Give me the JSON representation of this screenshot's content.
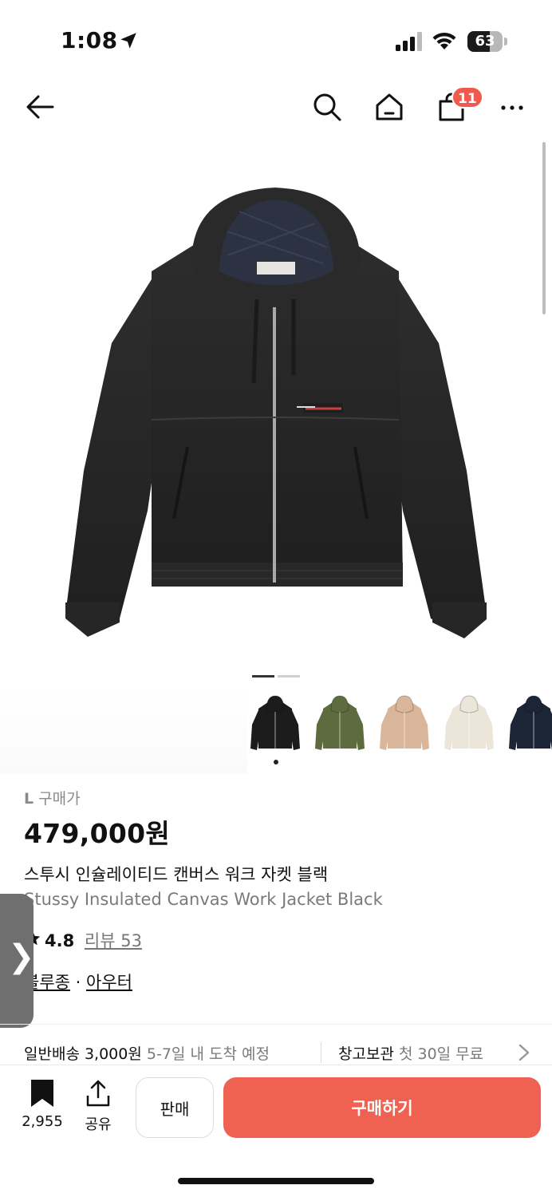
{
  "status_bar": {
    "time": "1:08",
    "battery": "63",
    "battery_level": 0.63
  },
  "nav": {
    "cart_badge": "11",
    "icons": [
      "back-arrow-icon",
      "search-icon",
      "home-icon",
      "shopping-bag-icon",
      "more-icon"
    ]
  },
  "gallery": {
    "page_count": 2,
    "current_page": 1,
    "thumbnails": [
      {
        "color": "#1c1c1c",
        "label": "black"
      },
      {
        "color": "#5d6b3e",
        "label": "olive"
      },
      {
        "color": "#d9b59a",
        "label": "camo-pink"
      },
      {
        "color": "#ece6da",
        "label": "natural"
      },
      {
        "color": "#1c2536",
        "label": "navy"
      }
    ],
    "selected_index": 0
  },
  "product": {
    "size": "L",
    "price_label": "구매가",
    "price": "479,000원",
    "name_ko": "스투시 인슐레이티드 캔버스 워크 자켓 블랙",
    "name_en": "Stussy Insulated Canvas Work Jacket Black",
    "rating": "4.8",
    "review_label": "리뷰 53",
    "categories": [
      "블루종",
      "아우터"
    ],
    "category_sep": " · "
  },
  "shipping": {
    "delivery_label": "일반배송",
    "delivery_fee": "3,000원",
    "delivery_eta": "5-7일 내 도착 예정",
    "storage_label": "창고보관",
    "storage_note": "첫 30일 무료"
  },
  "bottom_bar": {
    "bookmark_count": "2,955",
    "share_label": "공유",
    "sell_label": "판매",
    "buy_label": "구매하기"
  },
  "colors": {
    "accent": "#ef6252",
    "badge": "#ef5a4c"
  }
}
